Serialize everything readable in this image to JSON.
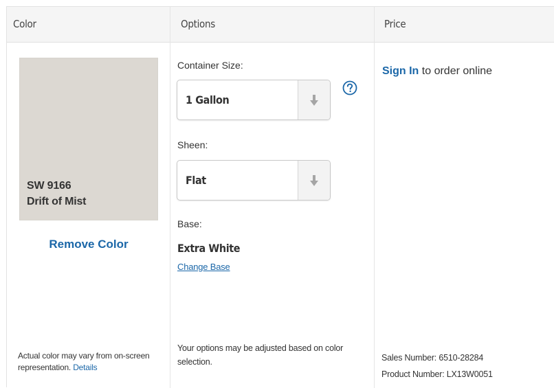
{
  "header": {
    "color_label": "Color",
    "options_label": "Options",
    "price_label": "Price"
  },
  "color": {
    "swatch_hex": "#dcd8d2",
    "number": "SW 9166",
    "name": "Drift of Mist",
    "remove_label": "Remove Color",
    "disclaimer": "Actual color may vary from on-screen representation.",
    "details_link": "Details"
  },
  "options": {
    "container_size": {
      "label": "Container Size:",
      "value": "1 Gallon",
      "icon": "arrow-down-icon"
    },
    "help_icon": "question-circle-icon",
    "sheen": {
      "label": "Sheen:",
      "value": "Flat",
      "icon": "arrow-down-icon"
    },
    "base": {
      "label": "Base:",
      "value": "Extra White",
      "change_link": "Change Base"
    },
    "note": "Your options may be adjusted based on color selection."
  },
  "price": {
    "sign_in_link": "Sign In",
    "sign_in_rest": "to order online",
    "sales_number": "Sales Number: 6510-28284",
    "product_number": "Product Number: LX13W0051"
  },
  "colors": {
    "link_blue": "#1b67a8",
    "header_bg": "#f5f5f5",
    "border": "#e2e2e2"
  }
}
